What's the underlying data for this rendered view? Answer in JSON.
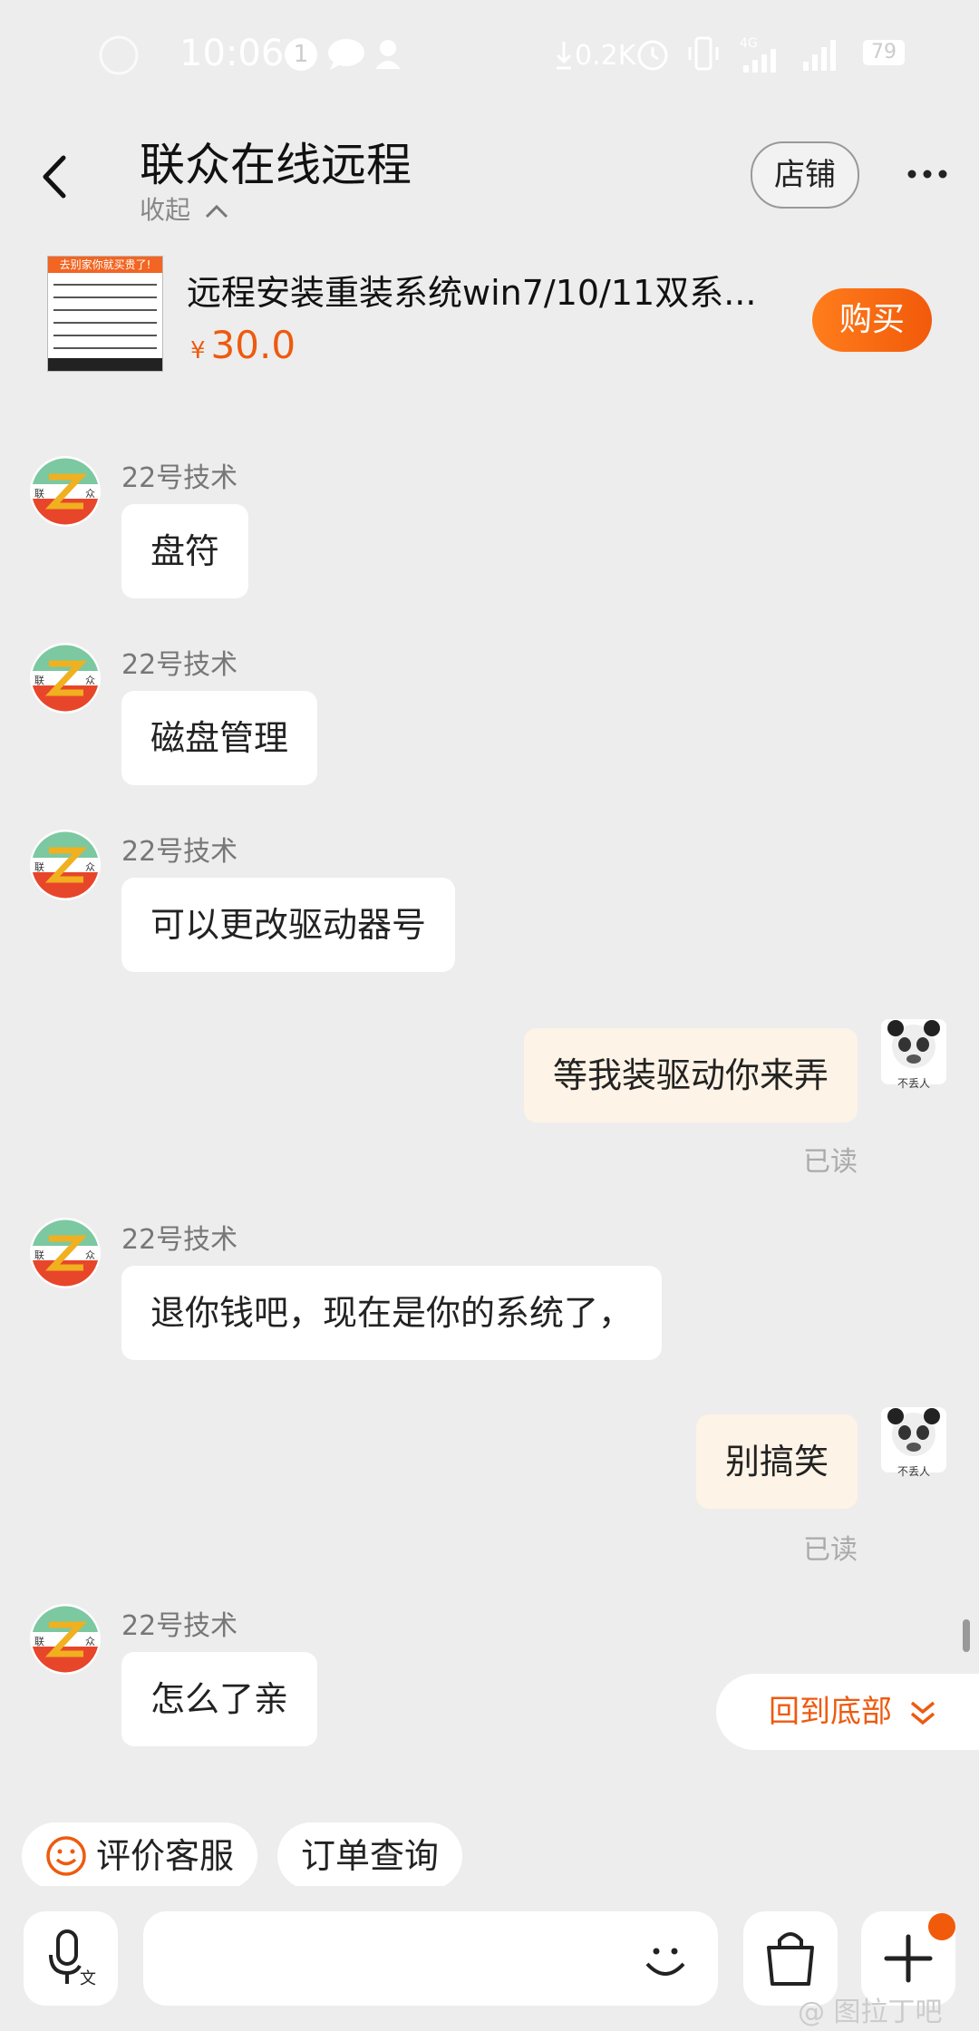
{
  "status_bar": {
    "time": "10:06",
    "notification_count": "1",
    "net_speed": "0.2K",
    "network_label": "4G",
    "battery": "79"
  },
  "header": {
    "title": "联众在线远程",
    "collapse_label": "收起",
    "shop_label": "店铺"
  },
  "product": {
    "title": "远程安装重装系统win7/10/11双系...",
    "currency": "¥",
    "price": "30.0",
    "buy_label": "购买",
    "thumb_header": "去别家你就买贵了!"
  },
  "messages": [
    {
      "sender": "22号技术",
      "text": "盘符"
    },
    {
      "sender": "22号技术",
      "text": "磁盘管理"
    },
    {
      "sender": "22号技术",
      "text": "可以更改驱动器号"
    },
    {
      "text": "等我装驱动你来弄",
      "status": "已读"
    },
    {
      "sender": "22号技术",
      "text": "退你钱吧，现在是你的系统了，"
    },
    {
      "text": "别搞笑",
      "status": "已读"
    },
    {
      "sender": "22号技术",
      "text": "怎么了亲"
    }
  ],
  "avatar_text": {
    "left": "联",
    "right": "众"
  },
  "panda_label": "不丢人",
  "jump_to_bottom": "回到底部",
  "quick_actions": {
    "rate_service": "评价客服",
    "order_query": "订单查询"
  },
  "watermark": "@ 图拉丁吧",
  "colors": {
    "accent": "#ee5a0f",
    "background": "#ededed",
    "outgoing_bubble": "#fdf3e6"
  }
}
